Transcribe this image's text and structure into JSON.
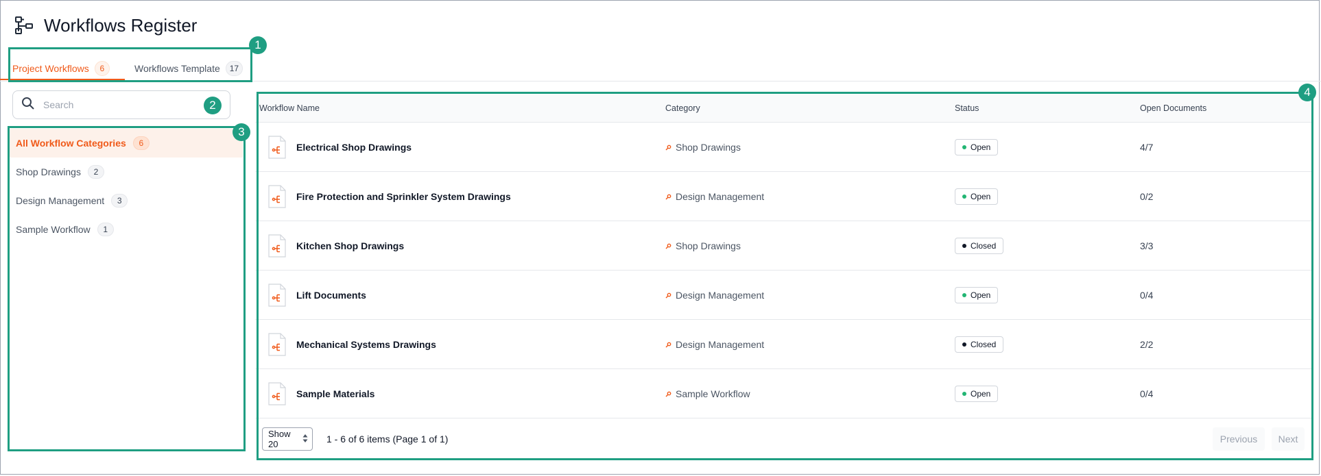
{
  "header": {
    "title": "Workflows Register",
    "icon": "workflow-icon"
  },
  "tabs": [
    {
      "label": "Project Workflows",
      "count": "6",
      "active": true
    },
    {
      "label": "Workflows Template",
      "count": "17",
      "active": false
    }
  ],
  "search": {
    "placeholder": "Search",
    "value": ""
  },
  "categories": [
    {
      "label": "All Workflow Categories",
      "count": "6",
      "active": true
    },
    {
      "label": "Shop Drawings",
      "count": "2",
      "active": false
    },
    {
      "label": "Design Management",
      "count": "3",
      "active": false
    },
    {
      "label": "Sample Workflow",
      "count": "1",
      "active": false
    }
  ],
  "table": {
    "columns": [
      "Workflow Name",
      "Category",
      "Status",
      "Open Documents"
    ],
    "rows": [
      {
        "name": "Electrical Shop Drawings",
        "category": "Shop Drawings",
        "status": "Open",
        "open_documents": "4/7"
      },
      {
        "name": "Fire Protection and Sprinkler System Drawings",
        "category": "Design Management",
        "status": "Open",
        "open_documents": "0/2"
      },
      {
        "name": "Kitchen Shop Drawings",
        "category": "Shop Drawings",
        "status": "Closed",
        "open_documents": "3/3"
      },
      {
        "name": "Lift Documents",
        "category": "Design Management",
        "status": "Open",
        "open_documents": "0/4"
      },
      {
        "name": "Mechanical Systems Drawings",
        "category": "Design Management",
        "status": "Closed",
        "open_documents": "2/2"
      },
      {
        "name": "Sample Materials",
        "category": "Sample Workflow",
        "status": "Open",
        "open_documents": "0/4"
      }
    ]
  },
  "footer": {
    "show_label": "Show 20",
    "range_text": "1 - 6 of 6 items (Page 1 of 1)",
    "prev_label": "Previous",
    "next_label": "Next"
  },
  "annotations": [
    "1",
    "2",
    "3",
    "4"
  ],
  "colors": {
    "accent": "#f05a1a",
    "annotation": "#1f9e82",
    "status_open": "#22b573",
    "status_closed": "#111827"
  }
}
